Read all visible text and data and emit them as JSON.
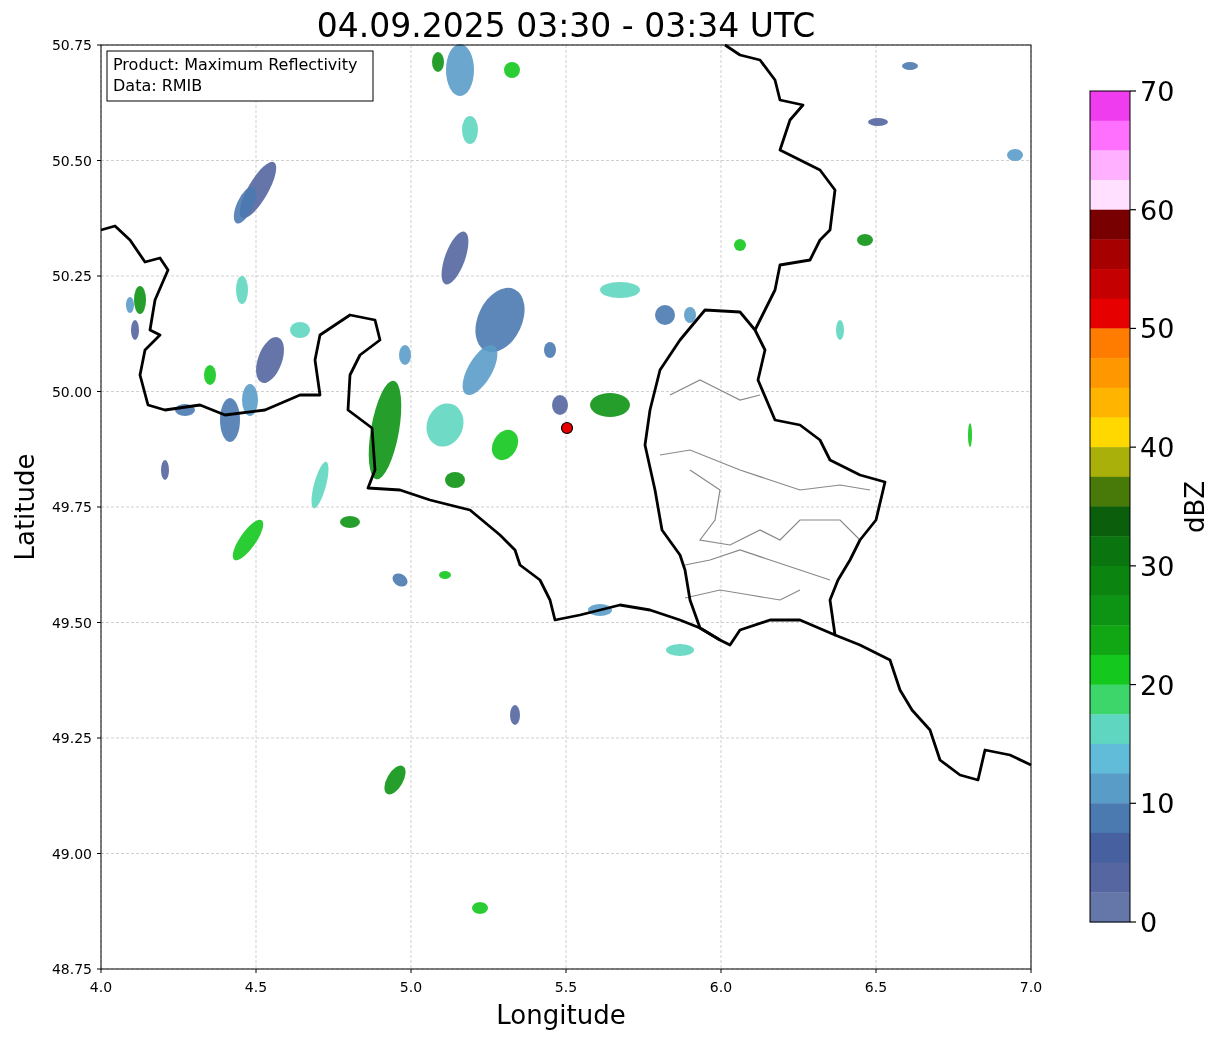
{
  "title": "04.09.2025 03:30 - 03:34 UTC",
  "annotation": [
    "Product: Maximum Reflectivity",
    "Data: RMIB"
  ],
  "axes": {
    "xlabel": "Longitude",
    "ylabel": "Latitude",
    "xticks": [
      "4.0",
      "4.5",
      "5.0",
      "5.5",
      "6.0",
      "6.5",
      "7.0"
    ],
    "yticks": [
      "50.75",
      "50.50",
      "50.25",
      "50.00",
      "49.75",
      "49.50",
      "49.25",
      "49.00",
      "48.75"
    ]
  },
  "colorbar": {
    "label": "dBZ",
    "ticks": [
      "70",
      "60",
      "50",
      "40",
      "30",
      "20",
      "10",
      "0"
    ],
    "segments": [
      {
        "color": "#ee3cee"
      },
      {
        "color": "#ff70ff"
      },
      {
        "color": "#ffb0ff"
      },
      {
        "color": "#ffe0ff"
      },
      {
        "color": "#780000"
      },
      {
        "color": "#a60000"
      },
      {
        "color": "#c40000"
      },
      {
        "color": "#e60000"
      },
      {
        "color": "#ff7c00"
      },
      {
        "color": "#ff9800"
      },
      {
        "color": "#ffb400"
      },
      {
        "color": "#ffd800"
      },
      {
        "color": "#aab00a"
      },
      {
        "color": "#487a0a"
      },
      {
        "color": "#0a5e0c"
      },
      {
        "color": "#0a740e"
      },
      {
        "color": "#0c8410"
      },
      {
        "color": "#0e9414"
      },
      {
        "color": "#10a614"
      },
      {
        "color": "#14c81e"
      },
      {
        "color": "#3dd66a"
      },
      {
        "color": "#5fd6c0"
      },
      {
        "color": "#60bcd8"
      },
      {
        "color": "#5a9cc8"
      },
      {
        "color": "#4a7ab0"
      },
      {
        "color": "#4660a0"
      },
      {
        "color": "#5566a0"
      },
      {
        "color": "#6576a8"
      }
    ]
  }
}
